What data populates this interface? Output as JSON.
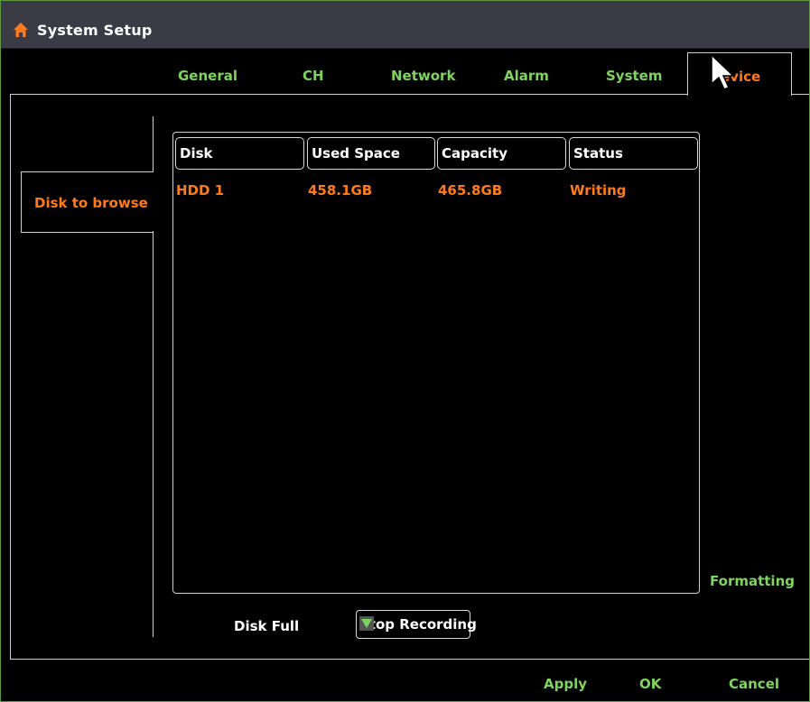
{
  "window": {
    "title": "System Setup"
  },
  "tabs": [
    {
      "label": "General"
    },
    {
      "label": "CH"
    },
    {
      "label": "Network"
    },
    {
      "label": "Alarm"
    },
    {
      "label": "System"
    },
    {
      "label": "evice",
      "active": true
    }
  ],
  "sidebar": {
    "items": [
      {
        "label": "Disk to browse",
        "active": true
      }
    ]
  },
  "disk_table": {
    "headers": [
      "Disk",
      "Used Space",
      "Capacity",
      "Status"
    ],
    "rows": [
      {
        "disk": "HDD 1",
        "used": "458.1GB",
        "capacity": "465.8GB",
        "status": "Writing"
      }
    ]
  },
  "actions": {
    "formatting": "Formatting"
  },
  "disk_full": {
    "label": "Disk Full",
    "value": "Stop Recording"
  },
  "footer": {
    "apply": "Apply",
    "ok": "OK",
    "cancel": "Cancel"
  },
  "colors": {
    "accent_green": "#7fd460",
    "accent_orange": "#ff7a1a",
    "titlebar": "#3a3b45",
    "background": "#000000"
  },
  "icons": {
    "title": "home-icon",
    "dropdown": "chevron-down-icon",
    "pointer": "mouse-cursor-icon"
  }
}
